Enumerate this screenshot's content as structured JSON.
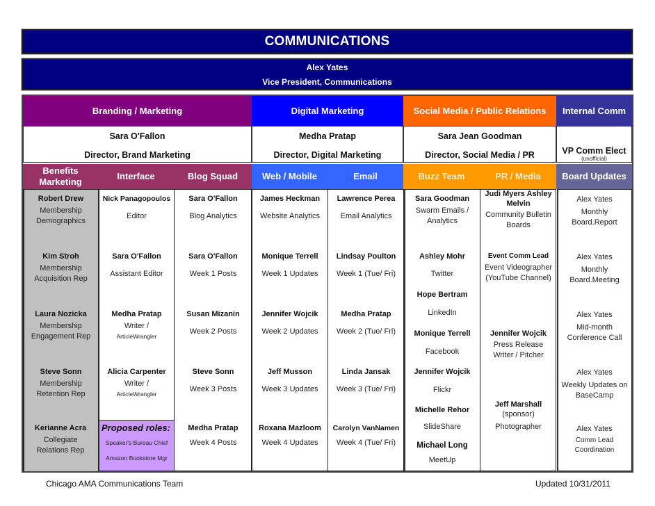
{
  "header": {
    "title": "COMMUNICATIONS",
    "vp_name": "Alex Yates",
    "vp_title": "Vice President, Communications"
  },
  "colors": {
    "title_bar": "#000080",
    "branding": "#800080",
    "branding_sub": "#993366",
    "digital": "#0000FF",
    "digital_sub": "#3366FF",
    "social": "#FF6600",
    "social_sub": "#FF9900",
    "internal": "#333399",
    "internal_sub": "#666699",
    "benefits_bg": "#C0C0C0",
    "proposed_bg": "#CC99FF"
  },
  "departments": [
    {
      "name": "Branding / Marketing",
      "director": "Sara O'Fallon",
      "director_title": "Director, Brand Marketing"
    },
    {
      "name": "Digital Marketing",
      "director": "Medha Pratap",
      "director_title": "Director, Digital Marketing"
    },
    {
      "name": "Social Media / Public Relations",
      "director": "Sara Jean Goodman",
      "director_title": "Director, Social Media / PR"
    },
    {
      "name": "Internal Comm",
      "director": "",
      "director_title": "VP Comm Elect",
      "director_note": "(unofficial)"
    }
  ],
  "teams": {
    "benefits": {
      "label": "Benefits Marketing",
      "members": [
        {
          "name": "Robert Drew",
          "role": "Membership Demographics"
        },
        {
          "name": "Kim Stroh",
          "role": "Membership Acquisition Rep"
        },
        {
          "name": "Laura Nozicka",
          "role": "Membership Engagement Rep"
        },
        {
          "name": "Steve Sonn",
          "role": "Membership Retention Rep"
        },
        {
          "name": "Kerianne Acra",
          "role": "Collegiate Relations Rep"
        }
      ]
    },
    "interface": {
      "label": "Interface",
      "members": [
        {
          "name": "Nick Panagopoulos",
          "role": "Editor"
        },
        {
          "name": "Sara O'Fallon",
          "role": "Assistant Editor"
        },
        {
          "name": "Medha Pratap",
          "role": "Writer /",
          "role2": "ArticleWrangler"
        },
        {
          "name": "Alicia Carpenter",
          "role": "Writer /",
          "role2": "ArticleWrangler"
        }
      ],
      "proposed": {
        "heading": "Proposed roles:",
        "roles": [
          "Speaker's Bureau Chief",
          "Amazon Bookstore Mgr"
        ]
      }
    },
    "blog": {
      "label": "Blog Squad",
      "members": [
        {
          "name": "Sara O'Fallon",
          "role": "Blog Analytics"
        },
        {
          "name": "Sara O'Fallon",
          "role": "Week 1 Posts"
        },
        {
          "name": "Susan Mizanin",
          "role": "Week 2 Posts"
        },
        {
          "name": "Steve Sonn",
          "role": "Week 3 Posts"
        },
        {
          "name": "Medha Pratap",
          "role": "Week 4 Posts"
        }
      ]
    },
    "web": {
      "label": "Web / Mobile",
      "members": [
        {
          "name": "James Heckman",
          "role": "Website Analytics"
        },
        {
          "name": "Monique Terrell",
          "role": "Week 1 Updates"
        },
        {
          "name": "Jennifer Wojcik",
          "role": "Week 2 Updates"
        },
        {
          "name": "Jeff Musson",
          "role": "Week 3 Updates"
        },
        {
          "name": "Roxana Mazloom",
          "role": "Week 4 Updates"
        }
      ]
    },
    "email": {
      "label": "Email",
      "members": [
        {
          "name": "Lawrence Perea",
          "role": "Email Analytics"
        },
        {
          "name": "Lindsay Poulton",
          "role": "Week 1 (Tue/ Fri)"
        },
        {
          "name": "Medha Pratap",
          "role": "Week 2 (Tue/ Fri)"
        },
        {
          "name": "Linda Jansak",
          "role": "Week 3 (Tue/ Fri)"
        },
        {
          "name": "Carolyn VanNamen",
          "role": "Week 4 (Tue/ Fri)"
        }
      ]
    },
    "buzz": {
      "label": "Buzz Team",
      "members": [
        {
          "name": "Sara Goodman",
          "role": "Swarm Emails / Analytics"
        },
        {
          "name": "Ashley Mohr",
          "role": "Twitter"
        },
        {
          "name": "Hope Bertram",
          "role": "LinkedIn"
        },
        {
          "name": "Monique Terrell",
          "role": "Facebook"
        },
        {
          "name": "Jennifer Wojcik",
          "role": "Flickr"
        },
        {
          "name": "Michelle Rehor",
          "role": "SlideShare"
        },
        {
          "name": "Michael Long",
          "role": "MeetUp"
        }
      ]
    },
    "pr": {
      "label": "PR / Media",
      "members": [
        {
          "name": "Judi Myers Ashley Melvin",
          "role": "Community Bulletin Boards"
        },
        {
          "name": "Event Comm Lead",
          "role": "Event Videographer (YouTube Channel)"
        },
        {
          "name": "Jennifer Wojcik",
          "role": "Press Release Writer / Pitcher"
        },
        {
          "name": "Jeff Marshall",
          "note": "(sponsor)",
          "role": "Photographer"
        }
      ]
    },
    "board": {
      "label": "Board Updates",
      "members": [
        {
          "name": "Alex Yates",
          "role": "Monthly Board.Report"
        },
        {
          "name": "Alex Yates",
          "role": "Monthly Board.Meeting"
        },
        {
          "name": "Alex Yates",
          "role": "Mid-month Conference Call"
        },
        {
          "name": "Alex Yates",
          "role": "Weekly Updates on BaseCamp"
        },
        {
          "name": "Alex Yates",
          "role": "Comm Lead Coordination"
        }
      ]
    }
  },
  "footer": {
    "left": "Chicago AMA Communications Team",
    "right": "Updated 10/31/2011"
  }
}
